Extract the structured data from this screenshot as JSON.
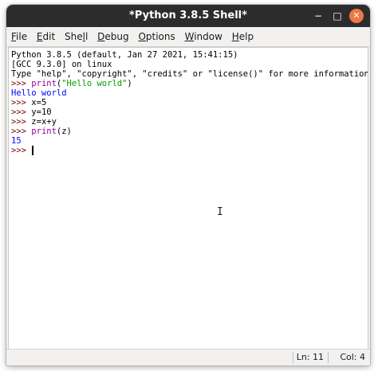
{
  "window": {
    "title": "*Python 3.8.5 Shell*",
    "controls": {
      "minimize": "−",
      "maximize": "□",
      "close": "✕"
    }
  },
  "menu": [
    {
      "mnemonic": "F",
      "rest": "ile"
    },
    {
      "mnemonic": "E",
      "rest": "dit"
    },
    {
      "pre": "She",
      "mnemonic": "l",
      "rest": "l"
    },
    {
      "mnemonic": "D",
      "rest": "ebug"
    },
    {
      "mnemonic": "O",
      "rest": "ptions"
    },
    {
      "mnemonic": "W",
      "rest": "indow"
    },
    {
      "mnemonic": "H",
      "rest": "elp"
    }
  ],
  "shell": {
    "banner": [
      "Python 3.8.5 (default, Jan 27 2021, 15:41:15)",
      "[GCC 9.3.0] on linux",
      "Type \"help\", \"copyright\", \"credits\" or \"license()\" for more information."
    ],
    "prompt": ">>> ",
    "line1": {
      "builtin": "print",
      "open": "(",
      "string": "\"Hello world\"",
      "close": ")"
    },
    "output1": "Hello world",
    "line2": "x=5",
    "line3": "y=10",
    "line4": "z=x+y",
    "line5": {
      "builtin": "print",
      "rest": "(z)"
    },
    "output2": "15",
    "ibeam": "I"
  },
  "status": {
    "line": "Ln: 11",
    "col": "Col: 4"
  },
  "colors": {
    "prompt": "#770000",
    "builtin": "#9000a0",
    "string": "#00a000",
    "output": "#0000ff",
    "titlebar": "#2c2c2c",
    "close": "#f07746"
  }
}
